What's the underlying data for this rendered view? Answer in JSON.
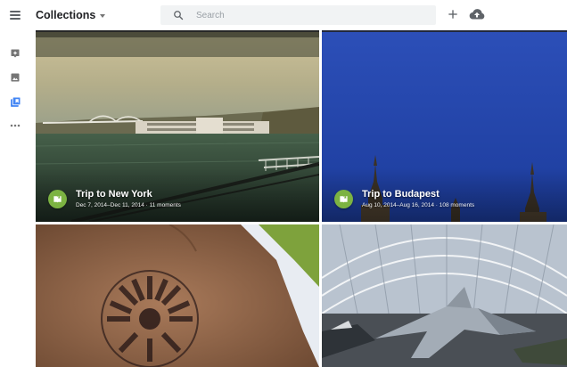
{
  "header": {
    "title": "Collections",
    "search_placeholder": "Search",
    "icons": {
      "menu": "menu-icon",
      "caret": "caret-down-icon",
      "search": "search-icon",
      "add": "add-icon",
      "upload": "cloud-upload-icon"
    }
  },
  "rail": {
    "items": [
      {
        "icon": "assistant-icon",
        "active": false
      },
      {
        "icon": "photos-icon",
        "active": false
      },
      {
        "icon": "albums-icon",
        "active": true
      },
      {
        "icon": "more-icon",
        "active": false
      }
    ],
    "active_color": "#4285f4",
    "inactive_color": "#757575"
  },
  "collections": [
    {
      "title": "Trip to New York",
      "meta": "Dec 7, 2014–Dec 11, 2014 · 11 moments",
      "scene": "river-bridge"
    },
    {
      "title": "Trip to Budapest",
      "meta": "Aug 10, 2014–Aug 16, 2014 · 108 moments",
      "scene": "blue-sky-spires"
    },
    {
      "title": "",
      "meta": "",
      "scene": "hand-stamp"
    },
    {
      "title": "",
      "meta": "",
      "scene": "aircraft-hangar"
    }
  ],
  "colors": {
    "album_badge": "#7cb342",
    "search_bg": "#f1f3f4"
  }
}
